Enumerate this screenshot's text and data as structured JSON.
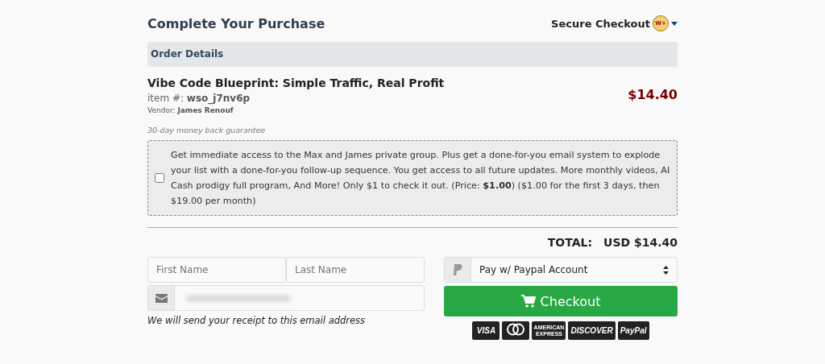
{
  "header": {
    "title": "Complete Your Purchase",
    "secure_label": "Secure Checkout",
    "badge": "W+"
  },
  "order": {
    "section_title": "Order Details",
    "product_name": "Vibe Code Blueprint: Simple Traffic, Real Profit",
    "item_label": "item #:",
    "item_id": "wso_j7nv6p",
    "vendor_label": "Vendor:",
    "vendor_name": "James Renouf",
    "price": "$14.40",
    "guarantee": "30-day money back guarantee"
  },
  "upsell": {
    "checked": false,
    "text": "Get immediate access to the Max and James private group. Plus get a done-for-you email system to explode your list with a done-for-you follow-up sequence. You get access to all future updates. More monthly videos, AI Cash prodigy full program, And More! Only $1 to check it out. (Price: **$1.00**) ($1.00 for the first 3 days, then $19.00 per month)"
  },
  "total": {
    "label": "TOTAL:",
    "value": "USD $14.40"
  },
  "form": {
    "first_name": {
      "placeholder": "First Name"
    },
    "last_name": {
      "placeholder": "Last Name"
    },
    "email_note": "We will send your receipt to this email address"
  },
  "payment": {
    "value": "Pay w/ Paypal Account",
    "button": "Checkout"
  },
  "cards": [
    {
      "kind": "text",
      "label": "VISA"
    },
    {
      "kind": "circles"
    },
    {
      "kind": "text",
      "label": "AMERICAN EXPRESS"
    },
    {
      "kind": "text",
      "label": "DISCOVER"
    },
    {
      "kind": "text",
      "label": "PayPal"
    }
  ]
}
